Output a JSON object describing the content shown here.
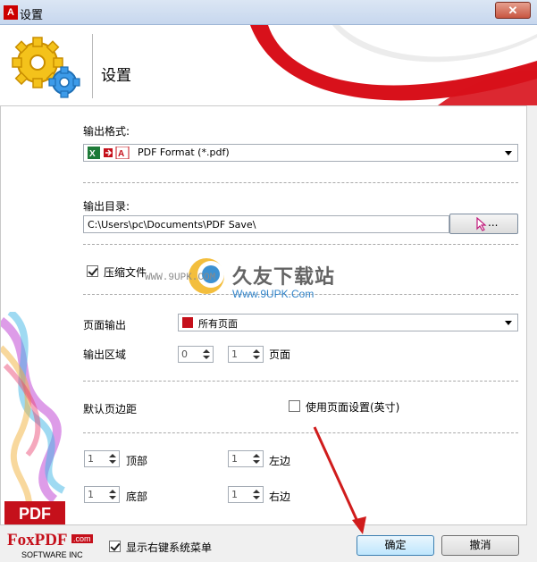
{
  "window": {
    "title": "设置",
    "close_symbol": "✕"
  },
  "header": {
    "title": "设置"
  },
  "output_format": {
    "label": "输出格式:",
    "selected": "PDF Format (*.pdf)"
  },
  "output_dir": {
    "label": "输出目录:",
    "value": "C:\\Users\\pc\\Documents\\PDF Save\\",
    "browse_label": "..."
  },
  "compress": {
    "label": "压缩文件",
    "checked": true
  },
  "page_output": {
    "label": "页面输出",
    "selected": "所有页面"
  },
  "output_range": {
    "label": "输出区域",
    "from": "0",
    "to": "1",
    "unit": "页面"
  },
  "margins": {
    "label": "默认页边距",
    "use_page_settings_label": "使用页面设置(英寸)",
    "use_page_settings_checked": false,
    "top_value": "1",
    "top_label": "顶部",
    "left_value": "1",
    "left_label": "左边",
    "bottom_value": "1",
    "bottom_label": "底部",
    "right_value": "1",
    "right_label": "右边"
  },
  "footer": {
    "logo_text": "FoxPDF",
    "logo_com": ".com",
    "logo_sub": "SOFTWARE INC",
    "context_menu_label": "显示右键系统菜单",
    "context_menu_checked": true,
    "ok_label": "确定",
    "cancel_label": "撤消"
  },
  "side_badge": "PDF",
  "watermark": {
    "title": "久友下载站",
    "url": "Www.9UPK.Com",
    "left_text": "WWW.9UPK.COM"
  },
  "colors": {
    "accent_red": "#c5101b",
    "default_button": "#3c7fb1"
  }
}
